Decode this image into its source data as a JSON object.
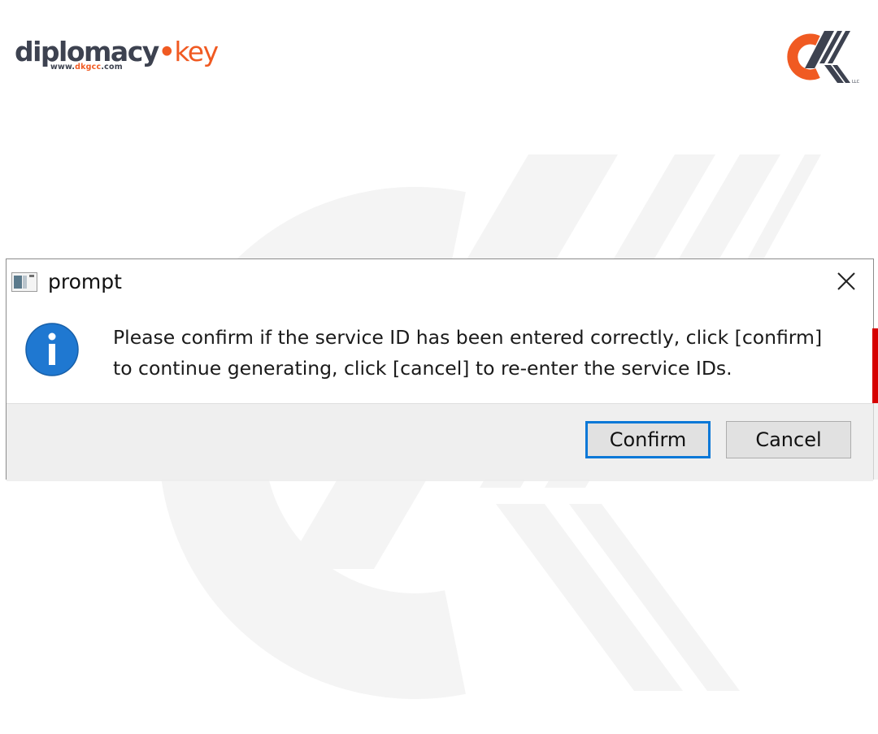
{
  "brand": {
    "name_main": "diplomacy",
    "name_dot": "•",
    "name_suffix": "key",
    "url_prefix": "www.",
    "url_accent": "dkgcc",
    "url_suffix": ".com"
  },
  "dialog": {
    "title": "prompt",
    "message": "Please confirm if the service ID has been entered correctly, click [confirm]\nto continue generating, click [cancel] to re-enter the service IDs.",
    "confirm_label": "Confirm",
    "cancel_label": "Cancel"
  },
  "colors": {
    "brand_orange": "#f05a22",
    "brand_dark": "#3d4250",
    "info_blue": "#1f78d1",
    "focus_blue": "#0a78d7"
  },
  "icons": {
    "app": "app-window-icon",
    "close": "close-icon",
    "info": "info-icon",
    "corner": "dk-logo-icon"
  }
}
